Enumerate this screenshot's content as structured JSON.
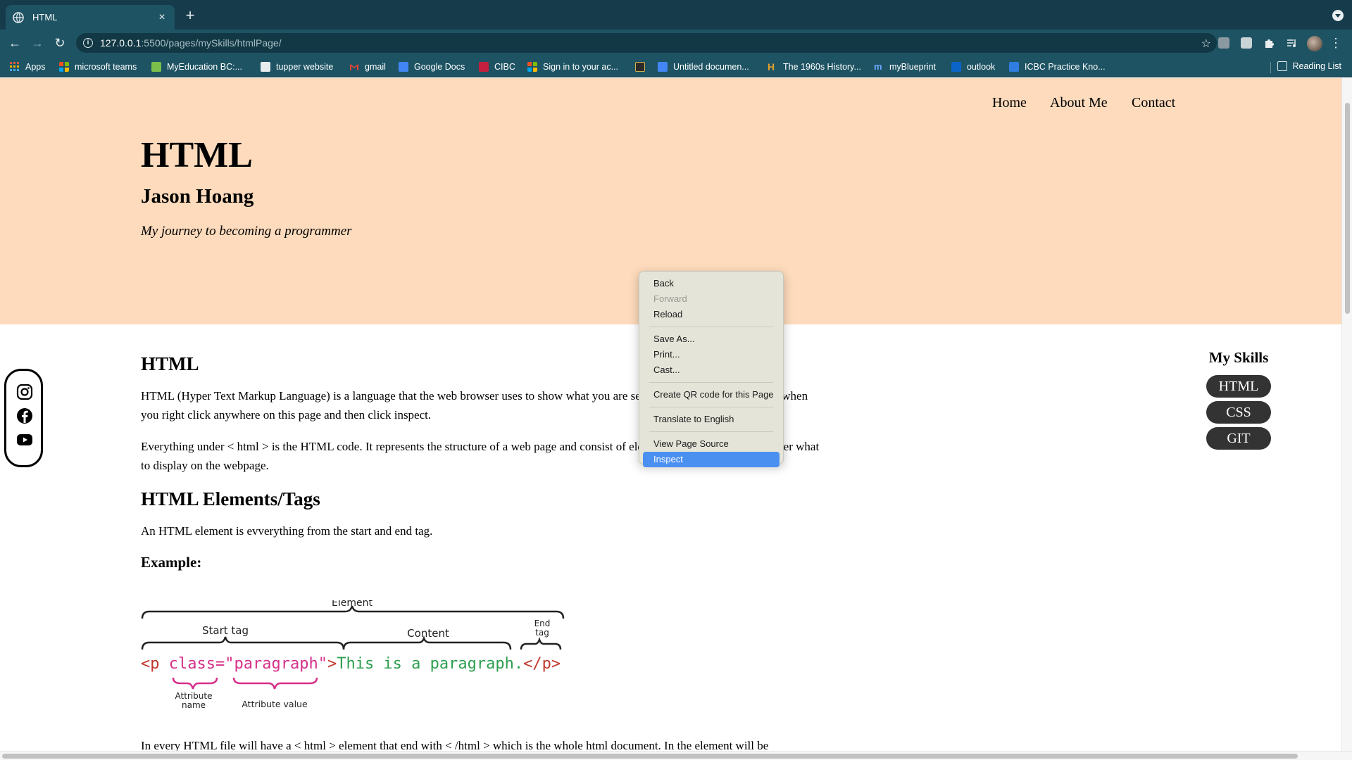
{
  "browser": {
    "tab_title": "HTML",
    "new_tab_label": "+",
    "url_host": "127.0.0.1",
    "url_path": ":5500/pages/mySkills/htmlPage/",
    "bookmarks": [
      "Apps",
      "microsoft teams",
      "MyEducation BC:...",
      "tupper website",
      "gmail",
      "Google Docs",
      "CIBC",
      "Sign in to your ac...",
      "",
      "Untitled documen...",
      "The 1960s History...",
      "myBlueprint",
      "outlook",
      "ICBC Practice Kno..."
    ],
    "reading_list": "Reading List"
  },
  "nav": {
    "home": "Home",
    "about": "About Me",
    "contact": "Contact"
  },
  "hero": {
    "title": "HTML",
    "name": "Jason Hoang",
    "tagline": "My journey to becoming a programmer"
  },
  "content": {
    "heading1": "HTML",
    "p1": "HTML (Hyper Text Markup Language) is a language that the web browser uses to show what you are seeing right now. For example, when you right click anywhere on this page and then click inspect.",
    "p2": "Everything under < html > is the HTML code. It represents the structure of a web page and consist of elements that tell the web browser what to display on the webpage.",
    "heading2": "HTML Elements/Tags",
    "p3": "An HTML element is evverything from the start and end tag.",
    "example_label": "Example:",
    "footer": "In every HTML file will have a < html > element that end with < /html > which is the whole html document. In the element will be"
  },
  "diagram": {
    "element": "Element",
    "start_tag": "Start tag",
    "content": "Content",
    "end_tag_1": "End",
    "end_tag_2": "tag",
    "attr_name_1": "Attribute",
    "attr_name_2": "name",
    "attr_value": "Attribute value",
    "code_open": "<p ",
    "code_attr": "class=",
    "code_q1": "\"",
    "code_value": "paragraph",
    "code_q2": "\"",
    "code_gt": ">",
    "code_text": "This is a paragraph.",
    "code_close": "</p>"
  },
  "skills": {
    "heading": "My Skills",
    "items": [
      "HTML",
      "CSS",
      "GIT"
    ]
  },
  "context_menu": {
    "back": "Back",
    "forward": "Forward",
    "reload": "Reload",
    "save_as": "Save As...",
    "print": "Print...",
    "cast": "Cast...",
    "qr": "Create QR code for this Page",
    "translate": "Translate to English",
    "view_source": "View Page Source",
    "inspect": "Inspect"
  },
  "colors": {
    "hero_bg": "#fddbbc",
    "chrome_dark": "#163b4b",
    "chrome_mid": "#1e5363",
    "code_red": "#c0392b",
    "code_pink": "#d62f8a",
    "code_green": "#2e9e4f",
    "menu_highlight": "#4a90f0"
  }
}
